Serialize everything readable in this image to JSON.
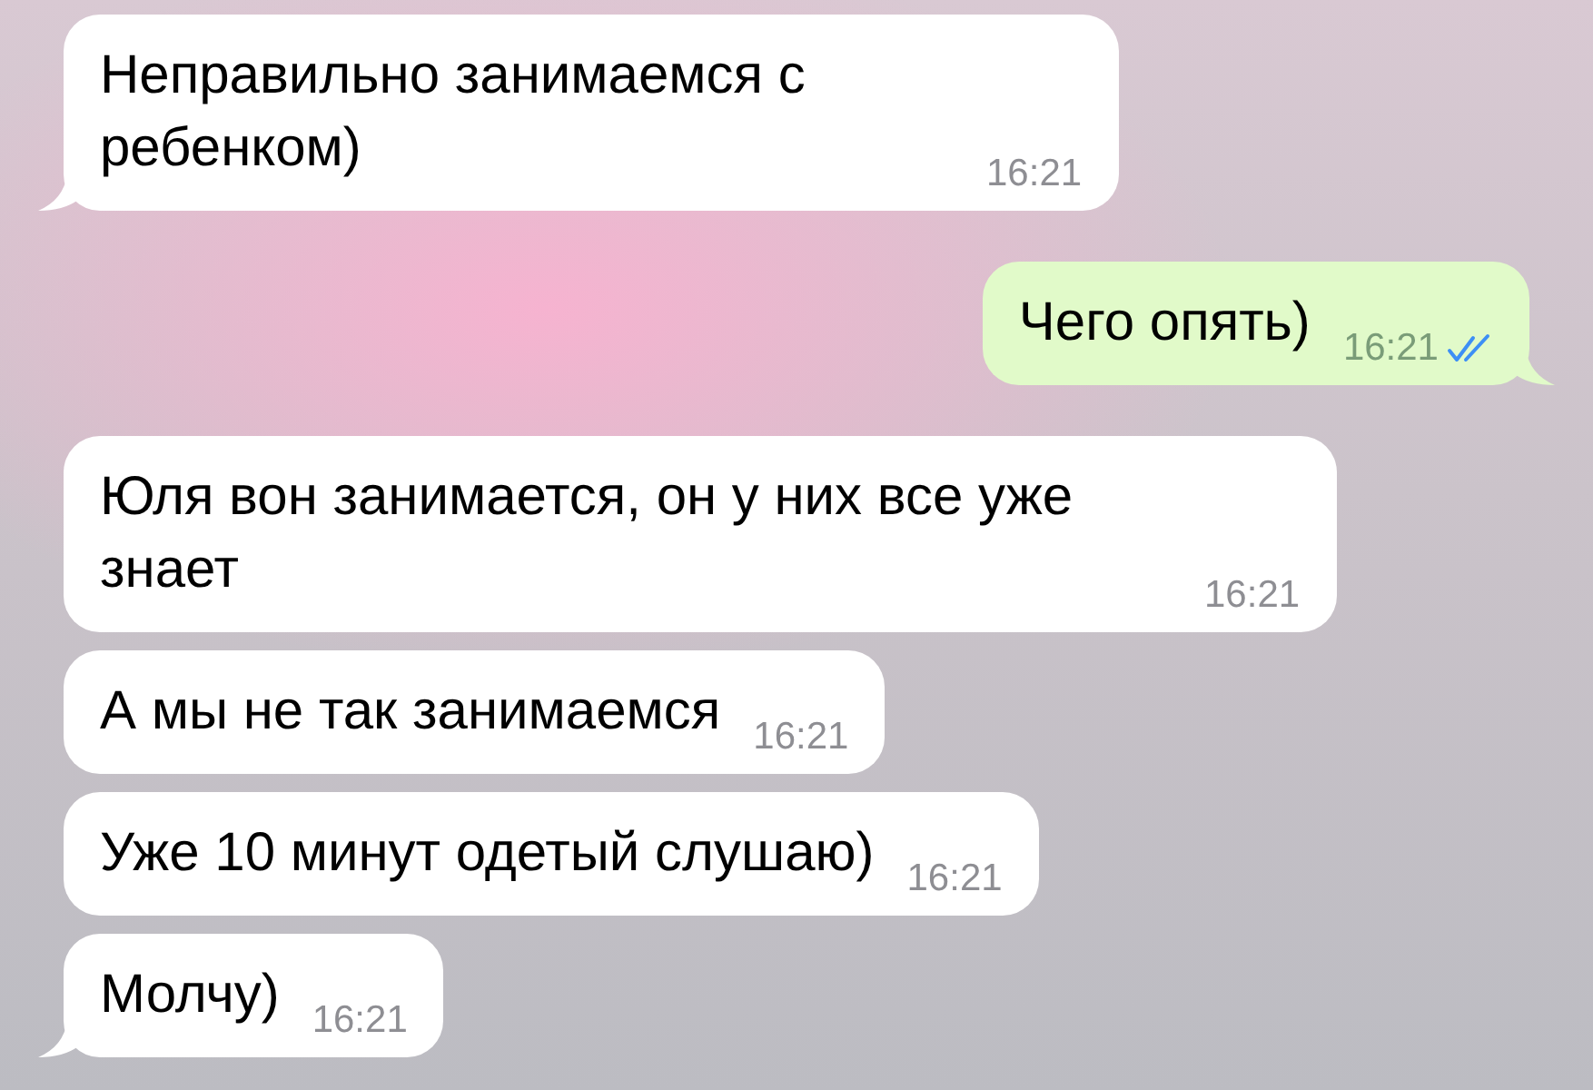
{
  "messages": [
    {
      "kind": "incoming",
      "text": "Неправильно занимаемся с ребенком)",
      "time": "16:21",
      "tail": true
    },
    {
      "kind": "outgoing",
      "text": "Чего опять)",
      "time": "16:21",
      "tail": true,
      "read": true
    },
    {
      "kind": "incoming",
      "text": "Юля вон занимается, он у них все уже знает",
      "time": "16:21",
      "tail": false
    },
    {
      "kind": "incoming",
      "text": "А мы не так занимаемся",
      "time": "16:21",
      "tail": false
    },
    {
      "kind": "incoming",
      "text": "Уже 10 минут одетый слушаю)",
      "time": "16:21",
      "tail": false
    },
    {
      "kind": "incoming",
      "text": "Молчу)",
      "time": "16:21",
      "tail": true
    }
  ]
}
